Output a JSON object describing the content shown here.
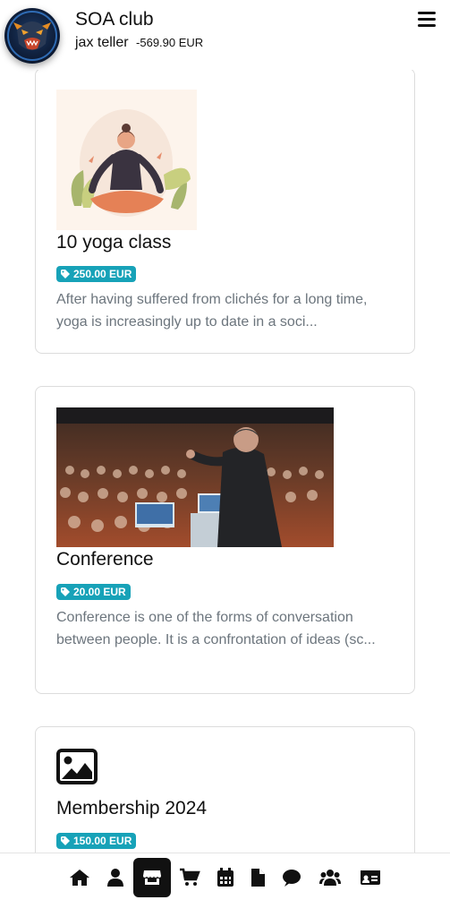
{
  "header": {
    "club_name": "SOA club",
    "user_name": "jax teller",
    "balance": "-569.90 EUR"
  },
  "products": [
    {
      "title": "10 yoga class",
      "price": "250.00 EUR",
      "description": "After having suffered from clichés for a long time, yoga is increasingly up to date in a soci...",
      "image": "yoga-illustration"
    },
    {
      "title": "Conference",
      "price": "20.00 EUR",
      "description": "Conference is one of the forms of conversation between people. It is a confrontation of ideas (sc...",
      "image": "conference-photo"
    },
    {
      "title": "Membership 2024",
      "price": "150.00 EUR",
      "description": "",
      "image": "image-placeholder-icon"
    }
  ],
  "bottom_nav": [
    {
      "icon": "home-icon"
    },
    {
      "icon": "user-icon"
    },
    {
      "icon": "shop-icon",
      "active": true
    },
    {
      "icon": "cart-icon"
    },
    {
      "icon": "calendar-icon"
    },
    {
      "icon": "document-icon"
    },
    {
      "icon": "chat-icon"
    },
    {
      "icon": "group-icon"
    },
    {
      "icon": "id-card-icon"
    }
  ],
  "colors": {
    "badge": "#17a2b8",
    "text_muted": "#6c757d",
    "active_nav": "#111111"
  }
}
